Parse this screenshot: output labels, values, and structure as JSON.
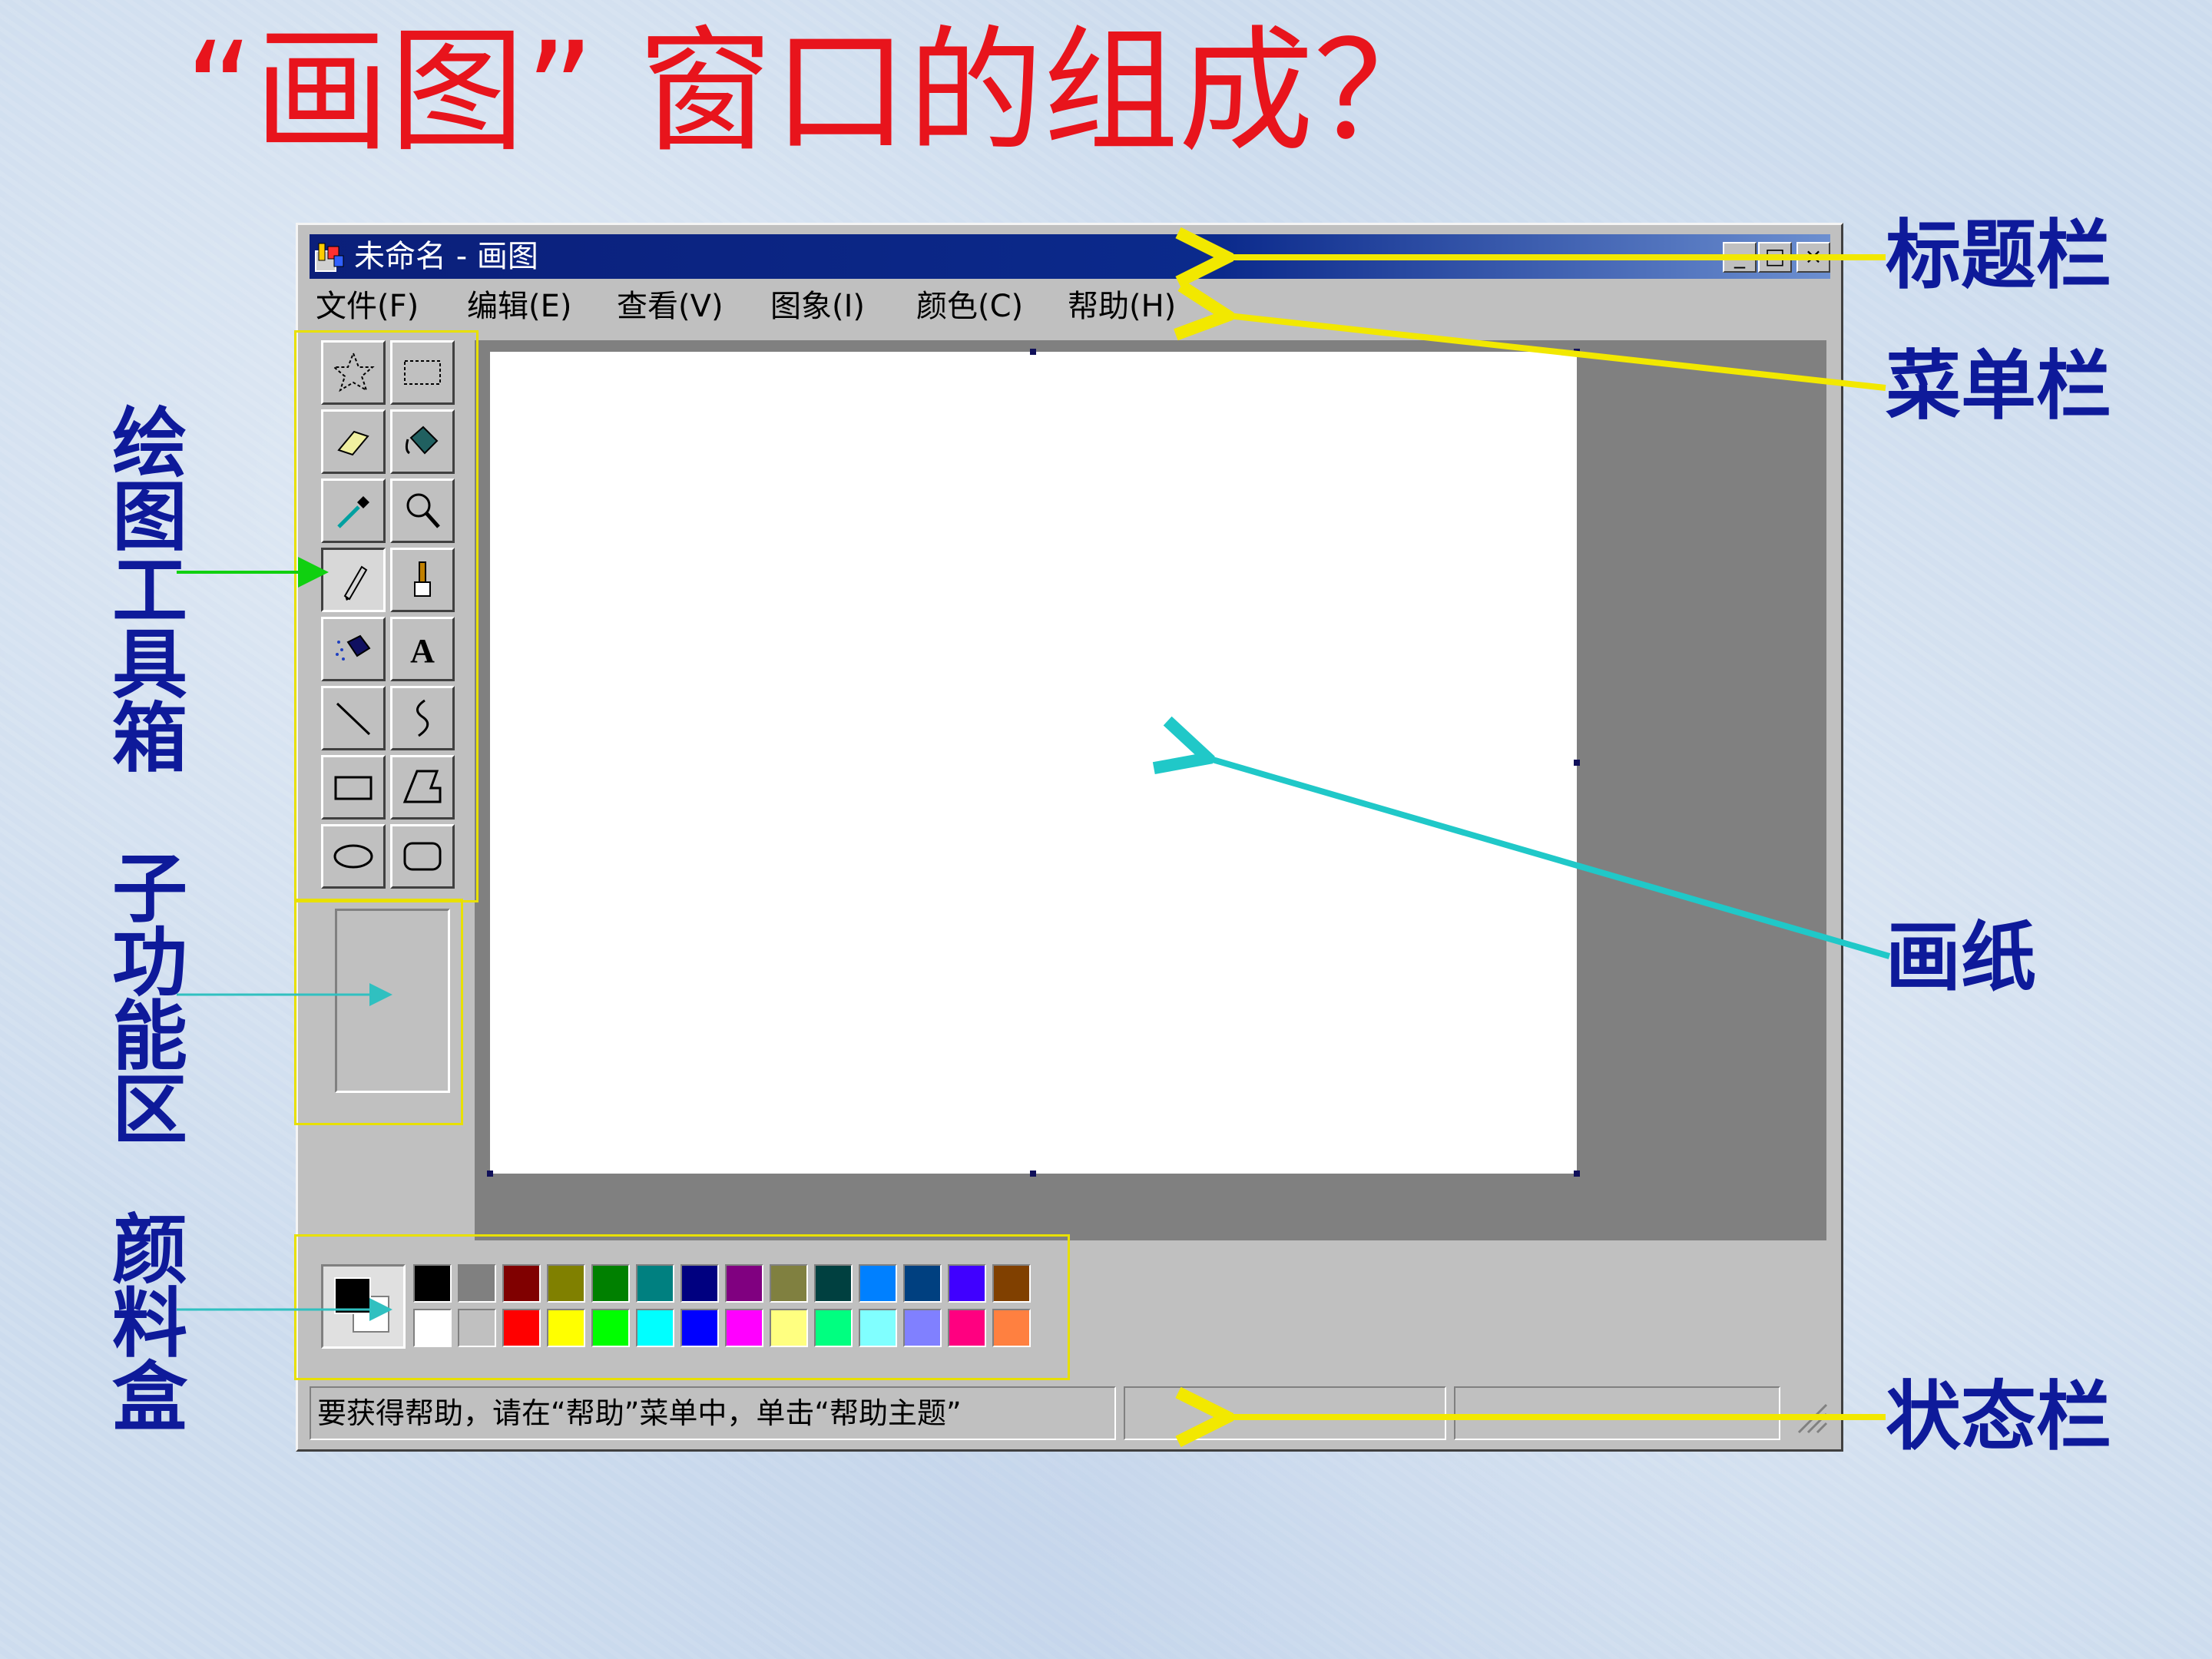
{
  "slide": {
    "title": "“画图” 窗口的组成？"
  },
  "labels": {
    "toolbox": "绘图工具箱",
    "subfunction": "子功能区",
    "palette": "颜料盒",
    "titlebar": "标题栏",
    "menubar": "菜单栏",
    "paper": "画纸",
    "statusbar": "状态栏"
  },
  "window": {
    "title": "未命名 - 画图",
    "buttons": {
      "minimize": "_",
      "maximize": "□",
      "close": "×"
    },
    "menu": [
      "文件(F)",
      "编辑(E)",
      "查看(V)",
      "图象(I)",
      "颜色(C)",
      "帮助(H)"
    ],
    "status": "要获得帮助，请在“帮助”菜单中，单击“帮助主题”"
  },
  "tools": [
    {
      "name": "free-form-select-icon"
    },
    {
      "name": "select-icon"
    },
    {
      "name": "eraser-icon"
    },
    {
      "name": "fill-bucket-icon"
    },
    {
      "name": "color-picker-icon"
    },
    {
      "name": "magnifier-icon"
    },
    {
      "name": "pencil-icon"
    },
    {
      "name": "brush-icon"
    },
    {
      "name": "airbrush-icon"
    },
    {
      "name": "text-icon"
    },
    {
      "name": "line-icon"
    },
    {
      "name": "curve-icon"
    },
    {
      "name": "rectangle-icon"
    },
    {
      "name": "polygon-icon"
    },
    {
      "name": "ellipse-icon"
    },
    {
      "name": "rounded-rectangle-icon"
    }
  ],
  "palette": {
    "foreground": "#000000",
    "background": "#ffffff",
    "top_row": [
      "#000000",
      "#808080",
      "#800000",
      "#808000",
      "#008000",
      "#008080",
      "#000080",
      "#800080",
      "#808040",
      "#004040",
      "#0080ff",
      "#004080",
      "#4000ff",
      "#804000"
    ],
    "bottom_row": [
      "#ffffff",
      "#c0c0c0",
      "#ff0000",
      "#ffff00",
      "#00ff00",
      "#00ffff",
      "#0000ff",
      "#ff00ff",
      "#ffff80",
      "#00ff80",
      "#80ffff",
      "#8080ff",
      "#ff0080",
      "#ff8040"
    ]
  }
}
